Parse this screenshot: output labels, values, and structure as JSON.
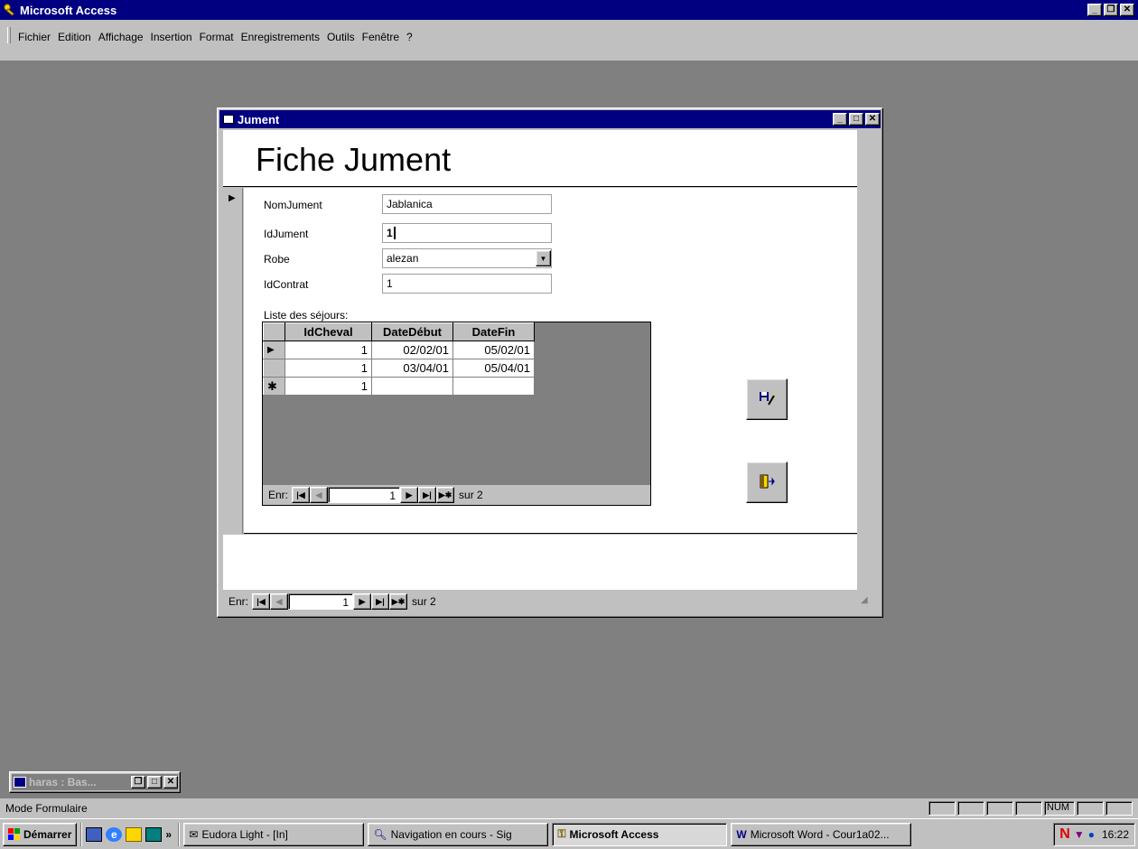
{
  "app": {
    "title": "Microsoft Access",
    "menu": [
      "Fichier",
      "Edition",
      "Affichage",
      "Insertion",
      "Format",
      "Enregistrements",
      "Outils",
      "Fenêtre",
      "?"
    ]
  },
  "form": {
    "window_title": "Jument",
    "heading": "Fiche Jument",
    "fields": {
      "nom_label": "NomJument",
      "nom_value": "Jablanica",
      "id_label": "IdJument",
      "id_value": "1",
      "robe_label": "Robe",
      "robe_value": "alezan",
      "contrat_label": "IdContrat",
      "contrat_value": "1"
    },
    "subform": {
      "label": "Liste des séjours:",
      "columns": [
        "IdCheval",
        "DateDébut",
        "DateFin"
      ],
      "rows": [
        {
          "selector": "▶",
          "IdCheval": "1",
          "DateDebut": "02/02/01",
          "DateFin": "05/02/01"
        },
        {
          "selector": "",
          "IdCheval": "1",
          "DateDebut": "03/04/01",
          "DateFin": "05/04/01"
        },
        {
          "selector": "✱",
          "IdCheval": "1",
          "DateDebut": "",
          "DateFin": ""
        }
      ],
      "nav": {
        "label": "Enr:",
        "record": "1",
        "total": "sur 2"
      }
    },
    "nav": {
      "label": "Enr:",
      "record": "1",
      "total": "sur 2"
    },
    "buttons": {
      "edit_icon": "save-edit-icon",
      "exit_icon": "exit-door-icon"
    }
  },
  "minimized": {
    "title": "haras : Bas..."
  },
  "status": {
    "text": "Mode Formulaire",
    "num": "NUM"
  },
  "taskbar": {
    "start": "Démarrer",
    "quicklaunch": [
      "desktop-icon",
      "ie-icon",
      "outlook-icon",
      "channel-icon"
    ],
    "chevron": "»",
    "tasks": [
      "Eudora Light - [In]",
      "Navigation en cours - Sig",
      "Microsoft Access",
      "Microsoft Word - Cour1a02..."
    ],
    "clock": "16:22"
  },
  "colors": {
    "titlebar": "#000080",
    "desktop": "#808080",
    "chrome": "#c0c0c0"
  }
}
